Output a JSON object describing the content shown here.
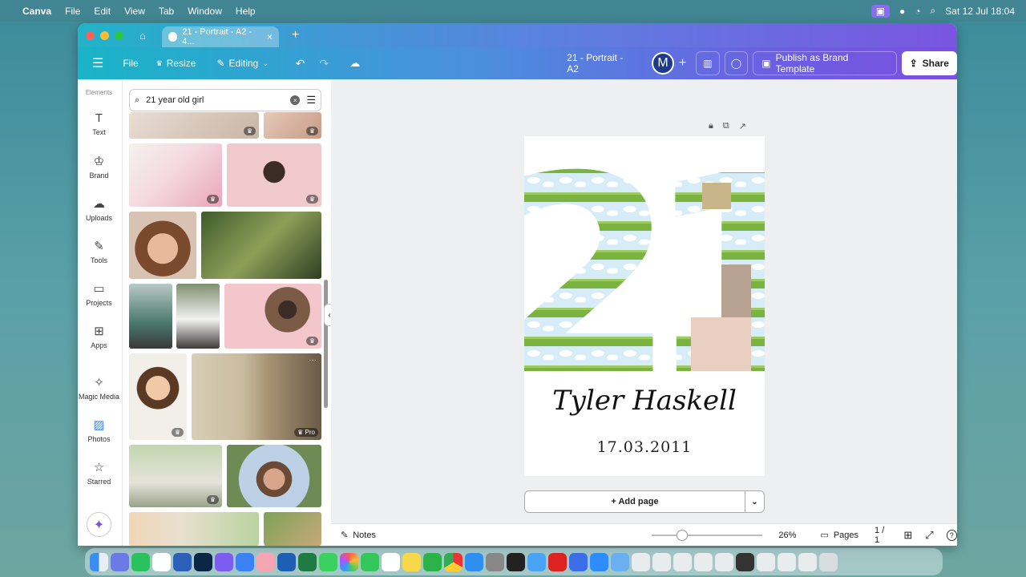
{
  "menubar": {
    "app": "Canva",
    "items": [
      "File",
      "Edit",
      "View",
      "Tab",
      "Window",
      "Help"
    ],
    "datetime": "Sat 12 Jul  18:04"
  },
  "browser": {
    "tab_title": "21 - Portrait - A2 - 4...",
    "new_tab": "+"
  },
  "toolbar": {
    "file": "File",
    "resize": "Resize",
    "editing": "Editing",
    "doc_title": "21 - Portrait - A2",
    "avatar": "M",
    "publish": "Publish as Brand Template",
    "share": "Share"
  },
  "rail": {
    "header": "Elements",
    "items": [
      {
        "label": "Text",
        "icon": "text-icon"
      },
      {
        "label": "Brand",
        "icon": "brand-icon"
      },
      {
        "label": "Uploads",
        "icon": "upload-icon"
      },
      {
        "label": "Tools",
        "icon": "tools-icon"
      },
      {
        "label": "Projects",
        "icon": "folder-icon"
      },
      {
        "label": "Apps",
        "icon": "apps-icon"
      },
      {
        "label": "Magic Media",
        "icon": "magic-media-icon"
      },
      {
        "label": "Photos",
        "icon": "photos-icon"
      },
      {
        "label": "Starred",
        "icon": "star-icon"
      }
    ]
  },
  "search": {
    "value": "21 year old girl"
  },
  "photos": {
    "pro_badge": "Pro"
  },
  "design": {
    "number": "21",
    "name": "Tyler Haskell",
    "date": "17.03.2011"
  },
  "canvas": {
    "add_page": "+ Add page"
  },
  "bottom": {
    "notes": "Notes",
    "zoom": "26%",
    "pages_label": "Pages",
    "page_count": "1 / 1",
    "zoom_level": 0.26
  },
  "colors": {
    "accent": "#7b4fe0",
    "grass": "#7bb341",
    "sky": "#cfe6f5"
  }
}
